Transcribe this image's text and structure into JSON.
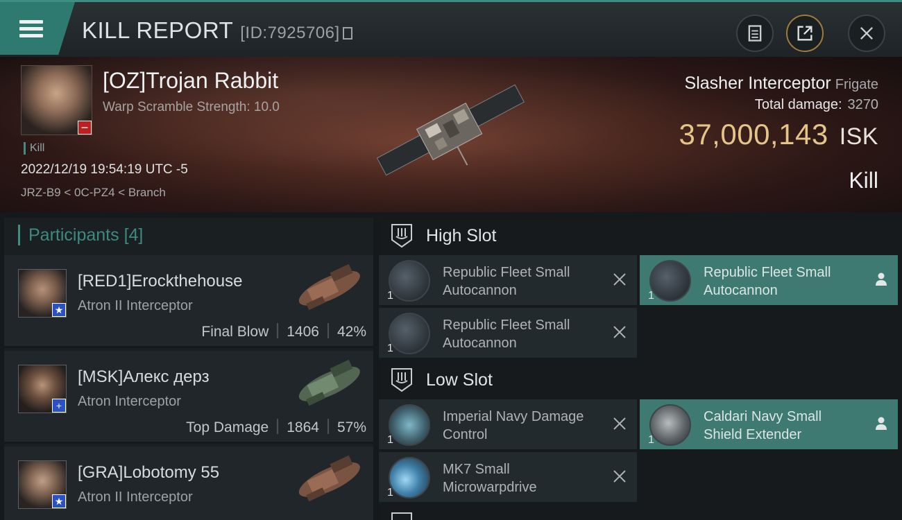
{
  "header": {
    "title": "KILL REPORT",
    "report_id": "[ID:7925706]"
  },
  "victim": {
    "name": "[OZ]Trojan Rabbit",
    "warp_scramble": "Warp Scramble Strength: 10.0",
    "kill_tag": "Kill",
    "date": "2022/12/19 19:54:19 UTC -5",
    "location": "JRZ-B9 < 0C-PZ4 < Branch"
  },
  "ship": {
    "name": "Slasher Interceptor",
    "class": "Frigate",
    "total_damage_label": "Total damage:",
    "total_damage_value": "3270",
    "isk_value": "37,000,143",
    "isk_unit": "ISK",
    "result": "Kill"
  },
  "participants": {
    "label": "Participants",
    "count": "[4]",
    "rows": [
      {
        "name": "[RED1]Erockthehouse",
        "ship": "Atron II Interceptor",
        "tag": "Final Blow",
        "damage": "1406",
        "percent": "42%",
        "badge": "★"
      },
      {
        "name": "[MSK]Алекс дерз",
        "ship": "Atron Interceptor",
        "tag": "Top Damage",
        "damage": "1864",
        "percent": "57%",
        "badge": "+"
      },
      {
        "name": "[GRA]Lobotomy 55",
        "ship": "Atron II Interceptor",
        "tag": "",
        "damage": "",
        "percent": "",
        "badge": "★"
      }
    ]
  },
  "slots": {
    "high": {
      "title": "High Slot",
      "destroyed": [
        {
          "name": "Republic Fleet Small Autocannon",
          "qty": "1"
        },
        {
          "name": "Republic Fleet Small Autocannon",
          "qty": "1"
        }
      ],
      "dropped": [
        {
          "name": "Republic Fleet Small Autocannon",
          "qty": "1"
        }
      ]
    },
    "low": {
      "title": "Low Slot",
      "destroyed": [
        {
          "name": "Imperial Navy Damage Control",
          "qty": "1"
        },
        {
          "name": "MK7 Small Microwarpdrive",
          "qty": "1"
        }
      ],
      "dropped": [
        {
          "name": "Caldari Navy Small Shield Extender",
          "qty": "1"
        }
      ]
    }
  },
  "colors": {
    "accent_teal": "#3f8e84",
    "isk_gold": "#e4c489",
    "panel_bg": "#1a1f22"
  }
}
